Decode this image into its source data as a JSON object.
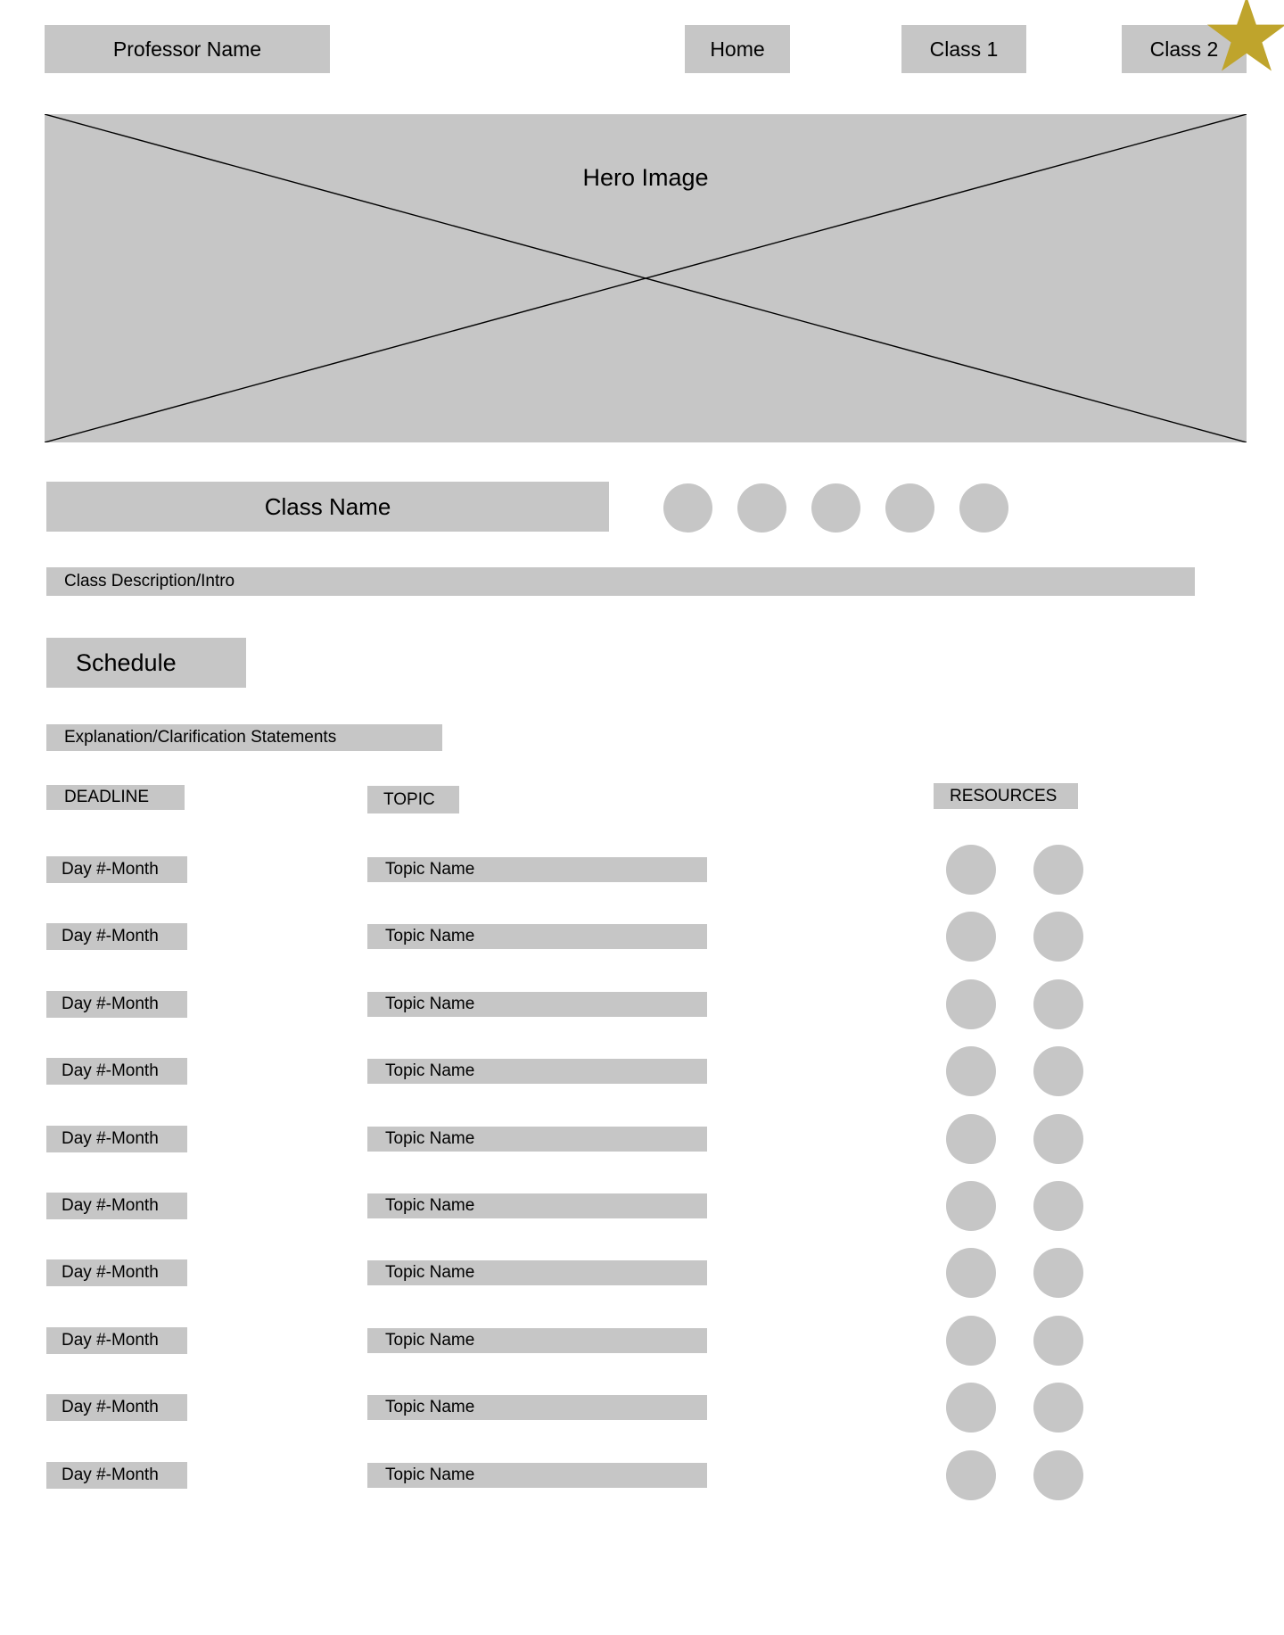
{
  "nav": {
    "brand": "Professor Name",
    "items": [
      {
        "label": "Home"
      },
      {
        "label": "Class 1"
      },
      {
        "label": "Class 2"
      }
    ],
    "star_badge": "star-icon"
  },
  "hero": {
    "label": "Hero Image"
  },
  "class_header": {
    "title": "Class Name",
    "social_icons": [
      "social-circle-1",
      "social-circle-2",
      "social-circle-3",
      "social-circle-4",
      "social-circle-5"
    ]
  },
  "description": {
    "text": "Class Description/Intro"
  },
  "schedule": {
    "heading": "Schedule",
    "explanation": "Explanation/Clarification Statements",
    "columns": {
      "deadline": "DEADLINE",
      "topic": "TOPIC",
      "resources": "RESOURCES"
    },
    "rows": [
      {
        "deadline": "Day #-Month",
        "topic": "Topic Name",
        "resources": [
          "resource-circle-1",
          "resource-circle-2"
        ]
      },
      {
        "deadline": "Day #-Month",
        "topic": "Topic Name",
        "resources": [
          "resource-circle-1",
          "resource-circle-2"
        ]
      },
      {
        "deadline": "Day #-Month",
        "topic": "Topic Name",
        "resources": [
          "resource-circle-1",
          "resource-circle-2"
        ]
      },
      {
        "deadline": "Day #-Month",
        "topic": "Topic Name",
        "resources": [
          "resource-circle-1",
          "resource-circle-2"
        ]
      },
      {
        "deadline": "Day #-Month",
        "topic": "Topic Name",
        "resources": [
          "resource-circle-1",
          "resource-circle-2"
        ]
      },
      {
        "deadline": "Day #-Month",
        "topic": "Topic Name",
        "resources": [
          "resource-circle-1",
          "resource-circle-2"
        ]
      },
      {
        "deadline": "Day #-Month",
        "topic": "Topic Name",
        "resources": [
          "resource-circle-1",
          "resource-circle-2"
        ]
      },
      {
        "deadline": "Day #-Month",
        "topic": "Topic Name",
        "resources": [
          "resource-circle-1",
          "resource-circle-2"
        ]
      },
      {
        "deadline": "Day #-Month",
        "topic": "Topic Name",
        "resources": [
          "resource-circle-1",
          "resource-circle-2"
        ]
      },
      {
        "deadline": "Day #-Month",
        "topic": "Topic Name",
        "resources": [
          "resource-circle-1",
          "resource-circle-2"
        ]
      }
    ]
  },
  "colors": {
    "placeholder_gray": "#c6c6c6",
    "star_gold": "#bfa42c",
    "text": "#000000",
    "background": "#ffffff",
    "hero_line": "#000000"
  }
}
